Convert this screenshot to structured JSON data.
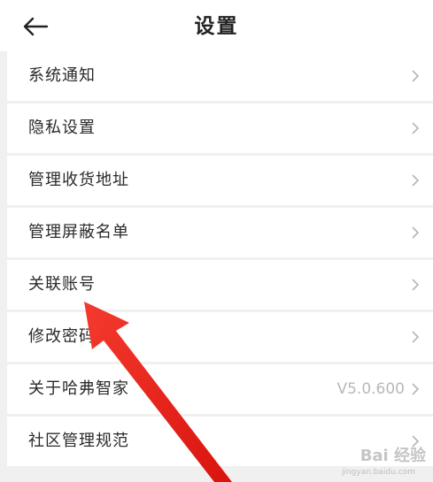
{
  "header": {
    "title": "设置",
    "back_icon": "arrow-left-icon"
  },
  "settings": {
    "items": [
      {
        "label": "系统通知",
        "value": ""
      },
      {
        "label": "隐私设置",
        "value": ""
      },
      {
        "label": "管理收货地址",
        "value": ""
      },
      {
        "label": "管理屏蔽名单",
        "value": ""
      },
      {
        "label": "关联账号",
        "value": ""
      },
      {
        "label": "修改密码",
        "value": ""
      },
      {
        "label": "关于哈弗智家",
        "value": "V5.0.600"
      },
      {
        "label": "社区管理规范",
        "value": ""
      }
    ]
  },
  "annotation": {
    "arrow_color": "#e8231f"
  },
  "watermark": {
    "text": "Bai 经验",
    "sub": "jingyan.baidu.com"
  }
}
